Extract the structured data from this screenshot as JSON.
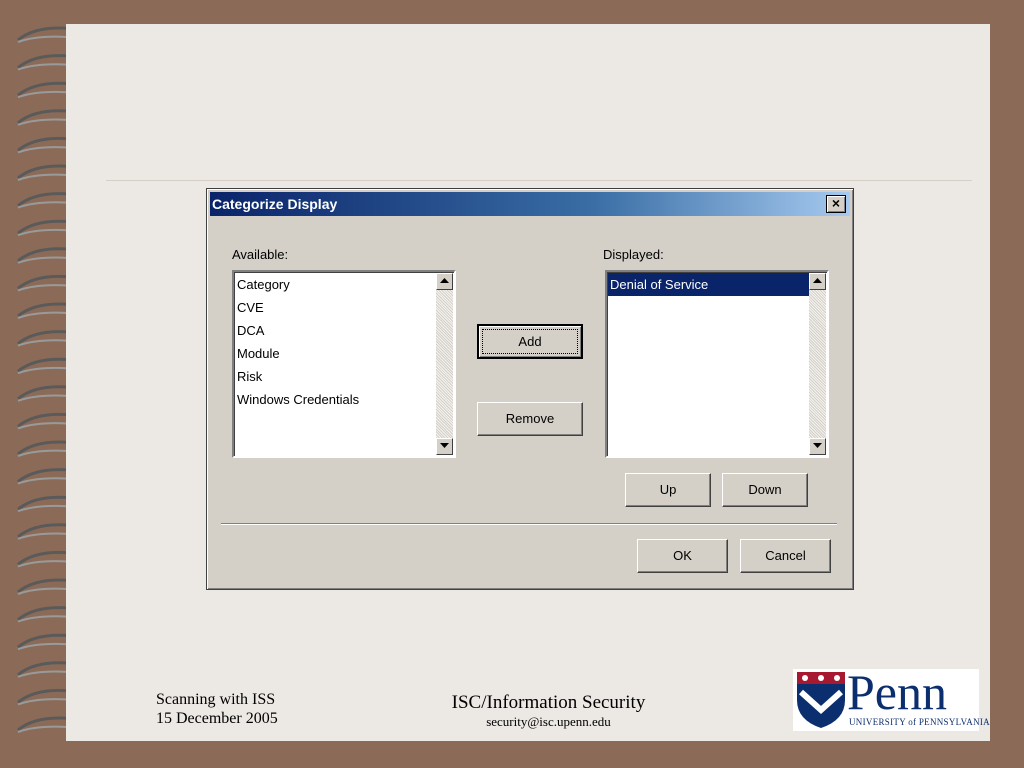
{
  "dialog": {
    "title": "Categorize Display",
    "close_label": "×",
    "available_label": "Available:",
    "displayed_label": "Displayed:",
    "available_items": [
      "Category",
      "CVE",
      "DCA",
      "Module",
      "Risk",
      "Windows Credentials"
    ],
    "displayed_items": [
      "Denial of Service"
    ],
    "add_label": "Add",
    "remove_label": "Remove",
    "up_label": "Up",
    "down_label": "Down",
    "ok_label": "OK",
    "cancel_label": "Cancel"
  },
  "footer": {
    "left_line1": "Scanning with ISS",
    "left_line2": "15 December 2005",
    "center_line1": "ISC/Information Security",
    "center_line2": "security@isc.upenn.edu"
  },
  "logo": {
    "word": "Penn",
    "subtitle": "UNIVERSITY of PENNSYLVANIA"
  },
  "colors": {
    "background": "#8b6b57",
    "slide": "#ece8e4",
    "titlebar_start": "#0a246a",
    "titlebar_end": "#a6caf0",
    "dialog_face": "#d4d0c8",
    "penn_blue": "#0b2e6f",
    "penn_red": "#a71930"
  },
  "icons": [
    "spiral-binding-icon",
    "close-icon",
    "scroll-up-arrow-icon",
    "scroll-down-arrow-icon",
    "penn-shield-icon"
  ]
}
